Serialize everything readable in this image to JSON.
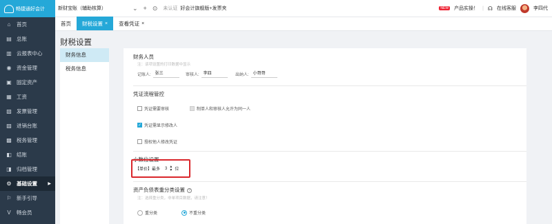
{
  "app": {
    "logo_text": "畅捷通好会计"
  },
  "sidebar": {
    "items": [
      {
        "label": "首页",
        "icon": "home-icon",
        "glyph": "⌂"
      },
      {
        "label": "总账",
        "icon": "ledger-icon",
        "glyph": "▤"
      },
      {
        "label": "云报表中心",
        "icon": "report-icon",
        "glyph": "▥"
      },
      {
        "label": "资金管理",
        "icon": "money-icon",
        "glyph": "◉"
      },
      {
        "label": "固定资产",
        "icon": "asset-icon",
        "glyph": "▣"
      },
      {
        "label": "工资",
        "icon": "salary-icon",
        "glyph": "▦"
      },
      {
        "label": "发票管理",
        "icon": "invoice-icon",
        "glyph": "▧"
      },
      {
        "label": "进销台账",
        "icon": "inventory-icon",
        "glyph": "▨"
      },
      {
        "label": "税务管理",
        "icon": "tax-icon",
        "glyph": "▩"
      },
      {
        "label": "结账",
        "icon": "close-book-icon",
        "glyph": "◧"
      },
      {
        "label": "归档管理",
        "icon": "archive-icon",
        "glyph": "◨"
      },
      {
        "label": "基础设置",
        "icon": "settings-icon",
        "glyph": "⚙",
        "active": true,
        "arrow": "▶"
      },
      {
        "label": "新手引导",
        "icon": "guide-icon",
        "glyph": "⚐"
      },
      {
        "label": "畅会员",
        "icon": "vip-icon",
        "glyph": "V"
      }
    ]
  },
  "topbar": {
    "company": "新财宝账（辅助核算）",
    "dropdown_glyph": "⌄",
    "add_glyph": "+",
    "settings_glyph": "⊙",
    "auth_status": "未认证",
    "edition": "好会计旗舰版+发票夹",
    "new_badge": "NEW",
    "promo": "产品实操！",
    "service": "在线客服",
    "user": "李四代"
  },
  "tabs": [
    {
      "label": "首页",
      "active": false,
      "closable": false
    },
    {
      "label": "财税设置",
      "active": true,
      "closable": true
    },
    {
      "label": "查看凭证",
      "active": false,
      "closable": true
    }
  ],
  "page": {
    "title": "财税设置"
  },
  "leftnav": [
    {
      "label": "财务信息",
      "active": true
    },
    {
      "label": "税务信息",
      "active": false
    }
  ],
  "finance_staff": {
    "title": "财务人员",
    "note": "注：该项设置的打印数据中显示",
    "bookkeeper_label": "记账人:",
    "bookkeeper_value": "张三",
    "auditor_label": "审核人:",
    "auditor_value": "李四",
    "cashier_label": "出纳人:",
    "cashier_value": "小哥哥"
  },
  "voucher_flow": {
    "title": "凭证流程管控",
    "opt_require_audit": "凭证需要审核",
    "opt_same_person": "制单人和审核人允许为同一人",
    "opt_show_modifier": "凭证需显示修改人",
    "opt_allow_modify": "授权他人修改凭证",
    "require_audit_checked": false,
    "same_person_checked": false,
    "show_modifier_checked": true,
    "allow_modify_checked": false,
    "check_glyph": "✓"
  },
  "decimal": {
    "title": "小数位设置",
    "label": "【单价】最多",
    "value": "3",
    "unit": "位",
    "up": "▲",
    "down": "▼"
  },
  "balance_sheet": {
    "title": "资产负债表重分类设置",
    "help": "?",
    "note": "注：选择重分类，非单项目数据，请注意！",
    "opt_reclass": "重分类",
    "opt_no_reclass": "不重分类",
    "selected": "不重分类"
  }
}
